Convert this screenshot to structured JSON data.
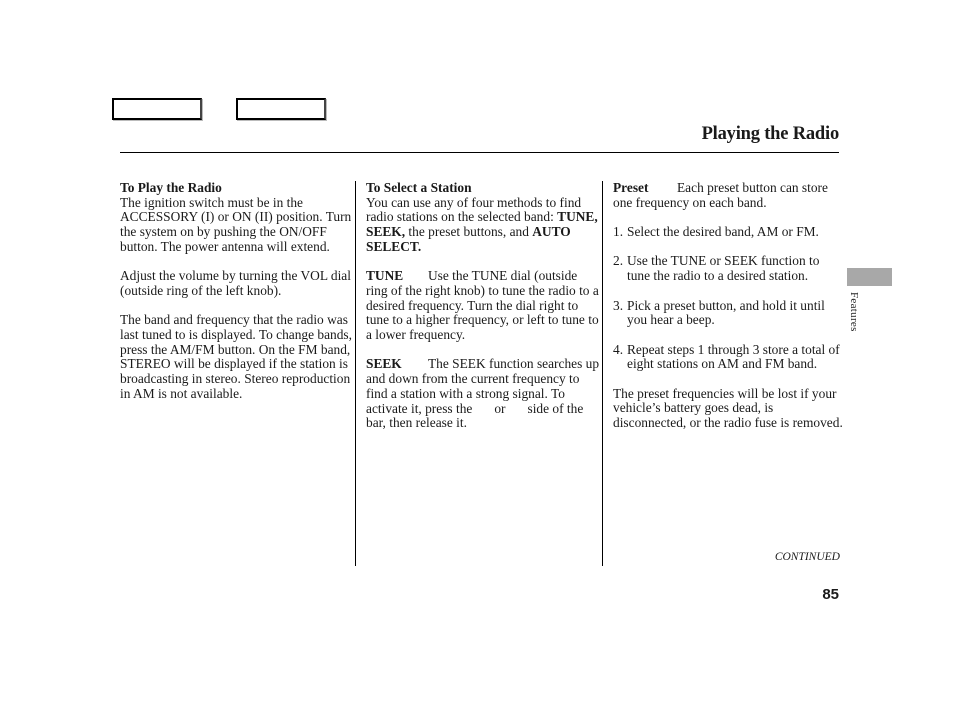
{
  "header": {
    "title": "Playing the Radio",
    "nav_buttons": [
      "previous-page",
      "next-page"
    ]
  },
  "columns": {
    "play": {
      "heading": "To Play the Radio",
      "paragraphs": [
        "The ignition switch must be in the ACCESSORY (I) or ON (II) position. Turn the system on by pushing the ON/OFF button. The power antenna will extend.",
        "Adjust the volume by turning the VOL dial (outside ring of the left knob).",
        "The band and frequency that the radio was last tuned to is displayed. To change bands, press the AM/FM button. On the FM band, STEREO will be displayed if the station is broadcasting in stereo. Stereo reproduction in AM is not available."
      ]
    },
    "select": {
      "heading": "To Select a Station",
      "intro_before": "You can use any of four methods to find radio stations on the selected band: ",
      "intro_bold1": "TUNE, SEEK,",
      "intro_mid": " the preset buttons, and ",
      "intro_bold2": "AUTO SELECT.",
      "tune_label": "TUNE",
      "tune_text": "Use the TUNE dial (outside ring of the right knob) to tune the radio to a desired frequency. Turn the dial right to tune to a higher frequency, or left to tune to a lower frequency.",
      "seek_label": "SEEK",
      "seek_text_1": "The SEEK function searches up and down from the current frequency to find a station with a strong signal. To activate it, press the",
      "seek_text_2": "or",
      "seek_text_3": "side of the bar, then release it."
    },
    "preset": {
      "label": "Preset",
      "intro": "Each preset button can store one frequency on each band.",
      "steps": [
        {
          "num": "1.",
          "text": "Select the desired band, AM or FM."
        },
        {
          "num": "2.",
          "text": "Use the TUNE or SEEK function to tune the radio to a desired station."
        },
        {
          "num": "3.",
          "text": "Pick a preset button, and hold it until you hear a beep."
        },
        {
          "num": "4.",
          "text": "Repeat steps 1 through 3 store a total of eight stations on AM and FM band."
        }
      ],
      "note": "The preset frequencies will be lost if your vehicle’s battery goes dead, is disconnected, or the radio fuse is removed."
    }
  },
  "side_tab": {
    "label": "Features",
    "color": "#a8a8a8"
  },
  "footer": {
    "continued": "CONTINUED",
    "page_number": "85"
  }
}
